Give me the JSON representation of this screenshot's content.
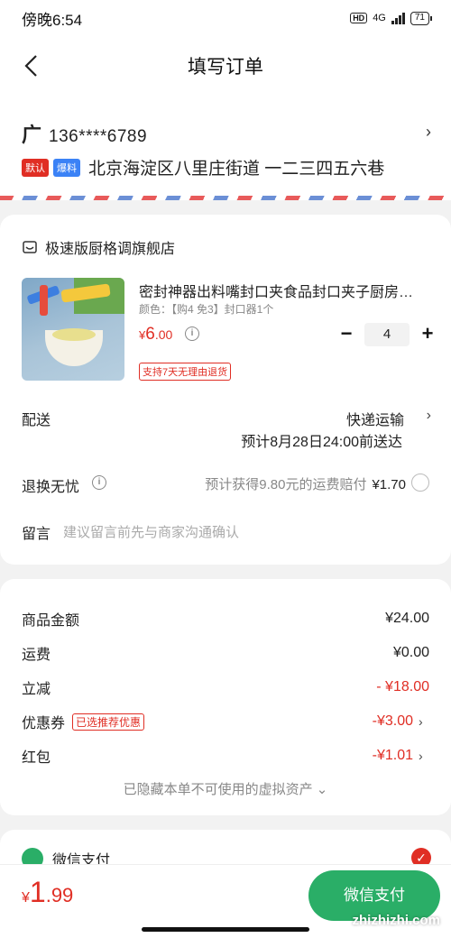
{
  "status": {
    "time": "傍晚6:54",
    "hd": "HD",
    "network": "4G",
    "battery": "71"
  },
  "nav": {
    "title": "填写订单"
  },
  "address": {
    "name": "广",
    "phone": "136****6789",
    "tags": [
      "默认",
      "爆料"
    ],
    "text": "北京海淀区八里庄街道 一二三四五六巷"
  },
  "shop": {
    "name": "极速版厨格调旗舰店"
  },
  "product": {
    "title": "密封神器出料嘴封口夹食品封口夹子厨房…",
    "spec": "颜色：【购4 免3】封口器1个",
    "price_symbol": "¥",
    "price_int": "6",
    "price_dec": ".00",
    "quantity": "4",
    "minus": "−",
    "plus": "+",
    "return_tag": "支持7天无理由退货"
  },
  "delivery": {
    "label": "配送",
    "method": "快递运输",
    "eta": "预计8月28日24:00前送达"
  },
  "return_worry": {
    "label": "退换无忧",
    "text": "预计获得9.80元的运费赔付",
    "price": "¥1.70"
  },
  "message": {
    "label": "留言",
    "placeholder": "建议留言前先与商家沟通确认"
  },
  "amounts": {
    "goods_label": "商品金额",
    "goods_value": "¥24.00",
    "shipping_label": "运费",
    "shipping_value": "¥0.00",
    "discount_label": "立减",
    "discount_value": "- ¥18.00",
    "coupon_label": "优惠券",
    "coupon_tag": "已选推荐优惠",
    "coupon_value": "-¥3.00",
    "redpacket_label": "红包",
    "redpacket_value": "-¥1.01",
    "hidden_assets": "已隐藏本单不可使用的虚拟资产 ⌄"
  },
  "payment": {
    "wechat_label": "微信支付",
    "check": "✓"
  },
  "bottom": {
    "total_symbol": "¥",
    "total_int": "1",
    "total_dec": ".99",
    "pay_button": "微信支付"
  },
  "watermark": "zhizhizhi.com",
  "colors": {
    "accent_red": "#e02e24",
    "wechat_green": "#2aae67",
    "tag_blue": "#3b82f6"
  }
}
